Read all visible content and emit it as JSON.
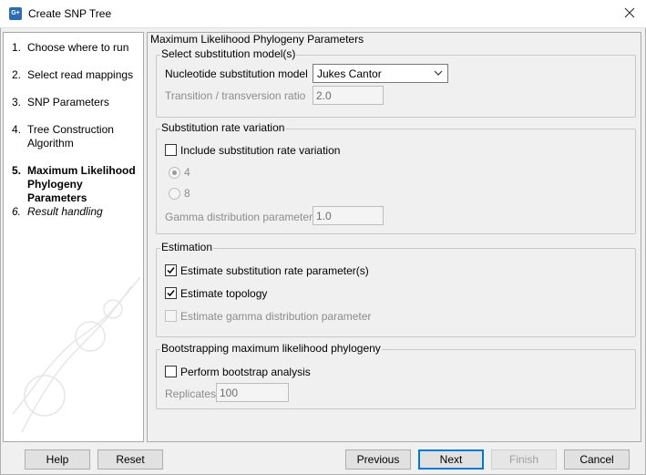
{
  "window": {
    "title": "Create SNP Tree",
    "app_icon_text": "G+",
    "close_icon": "close-icon"
  },
  "steps": [
    {
      "num": "1.",
      "label": "Choose where to run",
      "state": "done"
    },
    {
      "num": "2.",
      "label": "Select read mappings",
      "state": "done"
    },
    {
      "num": "3.",
      "label": "SNP Parameters",
      "state": "done"
    },
    {
      "num": "4.",
      "label": "Tree Construction\nAlgorithm",
      "state": "done"
    },
    {
      "num": "5.",
      "label": "Maximum Likelihood\nPhylogeny Parameters",
      "state": "current"
    },
    {
      "num": "6.",
      "label": "Result handling",
      "state": "future"
    }
  ],
  "panel": {
    "title": "Maximum Likelihood Phylogeny Parameters",
    "model_group": {
      "title": "Select substitution model(s)",
      "model_label": "Nucleotide substitution model",
      "model_value": "Jukes Cantor",
      "ratio_label": "Transition / transversion ratio",
      "ratio_value": "2.0"
    },
    "rate_group": {
      "title": "Substitution rate variation",
      "include_label": "Include substitution rate variation",
      "include_checked": false,
      "option_4": "4",
      "option_8": "8",
      "gamma_label": "Gamma distribution parameter",
      "gamma_value": "1.0"
    },
    "estimation_group": {
      "title": "Estimation",
      "rate_param_label": "Estimate substitution rate parameter(s)",
      "rate_param_checked": true,
      "topology_label": "Estimate topology",
      "topology_checked": true,
      "gamma_label": "Estimate gamma distribution parameter",
      "gamma_checked": false
    },
    "bootstrap_group": {
      "title": "Bootstrapping maximum likelihood phylogeny",
      "perform_label": "Perform bootstrap analysis",
      "perform_checked": false,
      "replicates_label": "Replicates",
      "replicates_value": "100"
    }
  },
  "buttons": {
    "help": "Help",
    "reset": "Reset",
    "previous": "Previous",
    "next": "Next",
    "finish": "Finish",
    "cancel": "Cancel"
  },
  "colors": {
    "accent": "#0078d7",
    "disabled_text": "#8c8c8c"
  }
}
